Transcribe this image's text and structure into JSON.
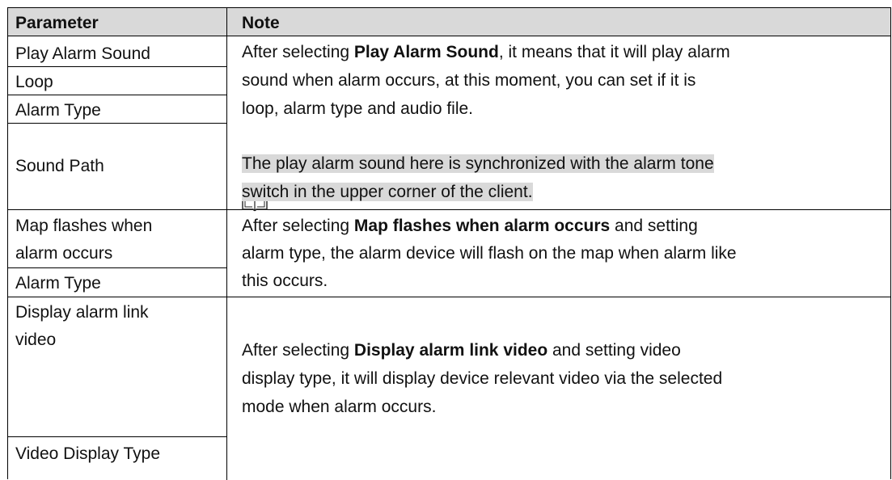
{
  "table": {
    "header": {
      "parameter": "Parameter",
      "note": "Note"
    },
    "parameters": {
      "play_alarm_sound": "Play Alarm Sound",
      "loop": "Loop",
      "alarm_type_1": "Alarm Type",
      "sound_path": "Sound Path",
      "map_flashes_1": "Map flashes when",
      "map_flashes_2": "alarm occurs",
      "alarm_type_2": "Alarm Type",
      "display_link_1": "Display alarm link",
      "display_link_2": "video",
      "video_display_type": "Video Display Type"
    },
    "notes": {
      "group1": {
        "l1_pre": "After selecting ",
        "l1_bold": "Play Alarm Sound",
        "l1_post": ", it means that it will play alarm",
        "l2": "sound when alarm occurs, at this moment, you can set if it is",
        "l3": "loop, alarm type and audio file.",
        "note_icon": "book-icon",
        "l4": "The play alarm sound here is synchronized with the alarm tone",
        "l5": "switch in the upper corner of the client."
      },
      "group2": {
        "l1_pre": "After selecting ",
        "l1_bold": "Map flashes when alarm occurs",
        "l1_post": " and setting",
        "l2": "alarm type, the alarm device will flash on the map when alarm like",
        "l3": "this occurs."
      },
      "group3": {
        "l1_pre": "After selecting ",
        "l1_bold": "Display alarm link video",
        "l1_post": " and setting video",
        "l2": "display type, it will display device relevant video via the selected",
        "l3": "mode when alarm occurs."
      }
    }
  },
  "colors": {
    "header_bg": "#d9d9d9",
    "highlight_bg": "#d9d9d9",
    "border": "#000000"
  }
}
